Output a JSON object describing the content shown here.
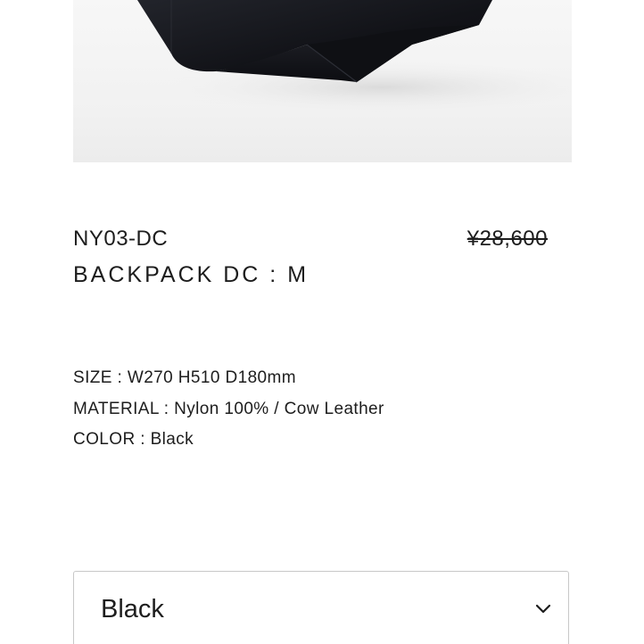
{
  "product": {
    "model_code": "NY03-DC",
    "name": "BACKPACK DC : M",
    "price": "¥28,600"
  },
  "specs": {
    "size": "SIZE : W270 H510 D180mm",
    "material": "MATERIAL : Nylon 100% / Cow Leather",
    "color": "COLOR : Black"
  },
  "variant_select": {
    "selected": "Black",
    "icon": "chevron-down-icon"
  },
  "colors": {
    "text": "#1d1d1d",
    "border": "#c8c8c8",
    "image_bg": "#f2f2f2",
    "bag": "#14151a"
  }
}
